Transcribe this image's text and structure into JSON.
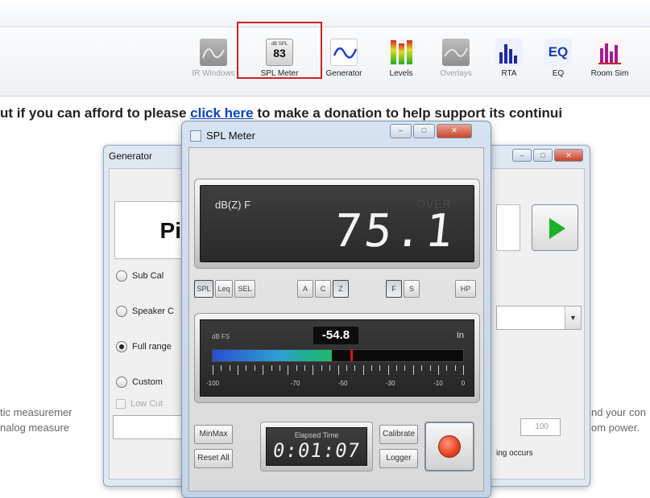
{
  "toolbar": {
    "items": [
      {
        "label": "IR Windows",
        "icon": "ir-windows-icon",
        "disabled": true
      },
      {
        "label": "SPL Meter",
        "icon": "spl-meter-icon",
        "disabled": false,
        "icon_text_top": "dB SPL",
        "icon_text_value": "83"
      },
      {
        "label": "Generator",
        "icon": "generator-icon",
        "disabled": false
      },
      {
        "label": "Levels",
        "icon": "levels-icon",
        "disabled": false
      },
      {
        "label": "Overlays",
        "icon": "overlays-icon",
        "disabled": true
      },
      {
        "label": "RTA",
        "icon": "rta-icon",
        "disabled": false
      },
      {
        "label": "EQ",
        "icon": "eq-icon",
        "disabled": false
      },
      {
        "label": "Room Sim",
        "icon": "room-sim-icon",
        "disabled": false
      }
    ],
    "highlight_color": "#d32020"
  },
  "donation": {
    "before": "ut if you can afford to please ",
    "link": "click here",
    "after": " to make a donation to help support its continui"
  },
  "background_text": {
    "left1": "tic measuremer",
    "left2": "nalog measure",
    "right1": "nd your con",
    "right2": "om power."
  },
  "generator": {
    "title": "Generator",
    "display_text": "Pi",
    "options": [
      {
        "label": "Sub Cal",
        "selected": false
      },
      {
        "label": "Speaker C",
        "selected": false
      },
      {
        "label": "Full range",
        "selected": true
      },
      {
        "label": "Custom",
        "selected": false
      }
    ],
    "low_cut_label": "Low Cut",
    "spin_value": "100",
    "status_text": "ing occurs"
  },
  "spl_meter": {
    "title": "SPL Meter",
    "lcd": {
      "unit_label": "dB(Z) F",
      "over_label": "OVER",
      "value": "75.1"
    },
    "mode_buttons": {
      "spl": "SPL",
      "leq": "Leq",
      "sel": "SEL",
      "a": "A",
      "c": "C",
      "z": "Z",
      "f": "F",
      "s": "S",
      "hp": "HP"
    },
    "bar": {
      "unit_label": "dB FS",
      "mode_label": "In",
      "peak_value": "-54.8",
      "fill_level_dbfs": -54.8,
      "peak_level_dbfs": -47,
      "axis_min": -100,
      "axis_max": 0,
      "tick_labels": [
        "-100",
        "-70",
        "-50",
        "-30",
        "-10",
        "0"
      ]
    },
    "buttons": {
      "minmax": "MinMax",
      "reset_all": "Reset All",
      "calibrate": "Calibrate",
      "logger": "Logger"
    },
    "timer": {
      "label": "Elapsed Time",
      "value": "0:01:07"
    },
    "colors": {
      "record": "#e8401f",
      "bar_start": "#2a4fd0",
      "bar_end": "#20b86e"
    }
  }
}
